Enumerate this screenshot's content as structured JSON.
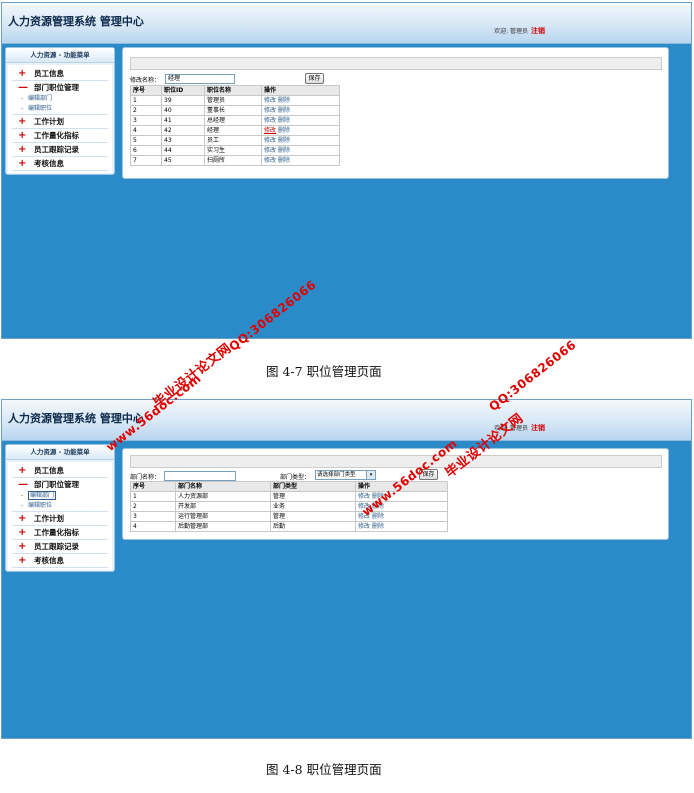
{
  "app": {
    "title": "人力资源管理系统  管理中心",
    "welcome": "欢迎: 管理员",
    "logout": "注销"
  },
  "sidebar": {
    "title": "人力资源 - 功能菜单",
    "items": [
      {
        "label": "员工信息",
        "symbol": "+"
      },
      {
        "label": "部门职位管理",
        "symbol": "—",
        "sub": [
          "编辑部门",
          "编辑职位"
        ]
      },
      {
        "label": "工作计划",
        "symbol": "+"
      },
      {
        "label": "工作量化指标",
        "symbol": "+"
      },
      {
        "label": "员工跟踪记录",
        "symbol": "+"
      },
      {
        "label": "考核信息",
        "symbol": "+"
      }
    ]
  },
  "screen1": {
    "edit_label": "修改名称：",
    "edit_value": "经理",
    "save": "保存",
    "headers": [
      "序号",
      "职位ID",
      "职位名称",
      "操作"
    ],
    "rows": [
      [
        "1",
        "39",
        "管理员"
      ],
      [
        "2",
        "40",
        "董事长"
      ],
      [
        "3",
        "41",
        "总经理"
      ],
      [
        "4",
        "42",
        "经理"
      ],
      [
        "5",
        "43",
        "员工"
      ],
      [
        "6",
        "44",
        "实习生"
      ],
      [
        "7",
        "45",
        "扫厕所"
      ]
    ],
    "op_edit": "修改",
    "op_delete": "删除"
  },
  "screen2": {
    "name_label": "部门名称：",
    "type_label": "部门类型：",
    "type_value": "请选择部门类型",
    "save": "保存",
    "headers": [
      "序号",
      "部门名称",
      "部门类型",
      "操作"
    ],
    "rows": [
      [
        "1",
        "人力资源部",
        "管理"
      ],
      [
        "2",
        "开发部",
        "业务"
      ],
      [
        "3",
        "运行管理部",
        "管理"
      ],
      [
        "4",
        "后勤管理部",
        "后勤"
      ]
    ],
    "op_edit": "修改",
    "op_delete": "删除"
  },
  "captions": {
    "fig1": "图 4-7    职位管理页面",
    "fig2": "图 4-8    职位管理页面"
  },
  "watermarks": {
    "site": "www.56doc.com",
    "qq": "QQ:306826066",
    "brand": "毕业设计论文网"
  },
  "colors": {
    "desktop": "#2b8bc9",
    "accent_red": "#d10000",
    "link": "#2b5c8a"
  }
}
